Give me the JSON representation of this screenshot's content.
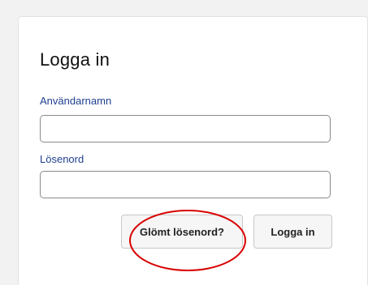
{
  "login": {
    "title": "Logga in",
    "username_label": "Användarnamn",
    "username_value": "",
    "password_label": "Lösenord",
    "password_value": "",
    "forgot_button": "Glömt lösenord?",
    "submit_button": "Logga in"
  },
  "colors": {
    "label": "#1f3f8f",
    "annotation": "#d90000"
  }
}
